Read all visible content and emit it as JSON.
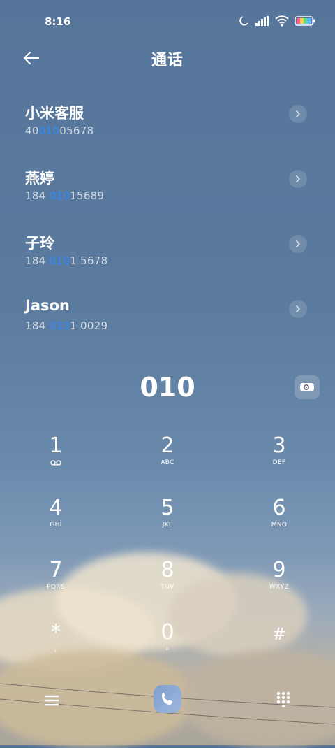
{
  "status": {
    "time": "8:16"
  },
  "header": {
    "title": "通话"
  },
  "contacts": [
    {
      "name": "小米客服",
      "number_pre": "40",
      "number_match": "010",
      "number_post": "05678"
    },
    {
      "name": "燕婷",
      "number_pre": "184 ",
      "number_match": "010",
      "number_post": "15689"
    },
    {
      "name": "子玲",
      "number_pre": "184 ",
      "number_match": "010",
      "number_post": "1 5678"
    },
    {
      "name": "Jason",
      "number_pre": "184 ",
      "number_match": "010",
      "number_post": "1 0029"
    }
  ],
  "dialer": {
    "entered": "010"
  },
  "keypad": [
    {
      "digit": "1",
      "letters": ""
    },
    {
      "digit": "2",
      "letters": "ABC"
    },
    {
      "digit": "3",
      "letters": "DEF"
    },
    {
      "digit": "4",
      "letters": "GHI"
    },
    {
      "digit": "5",
      "letters": "JKL"
    },
    {
      "digit": "6",
      "letters": "MNO"
    },
    {
      "digit": "7",
      "letters": "PQRS"
    },
    {
      "digit": "8",
      "letters": "TUV"
    },
    {
      "digit": "9",
      "letters": "WXYZ"
    },
    {
      "digit": "*",
      "letters": ","
    },
    {
      "digit": "0",
      "letters": "+"
    },
    {
      "digit": "#",
      "letters": ""
    }
  ],
  "icons": {
    "back": "arrow-left-icon",
    "chevron": "chevron-right-icon",
    "video": "video-call-icon",
    "voicemail": "voicemail-icon",
    "menu": "menu-icon",
    "call": "phone-icon",
    "dialpad": "dialpad-icon"
  },
  "colors": {
    "match_highlight": "#2d8bff"
  }
}
